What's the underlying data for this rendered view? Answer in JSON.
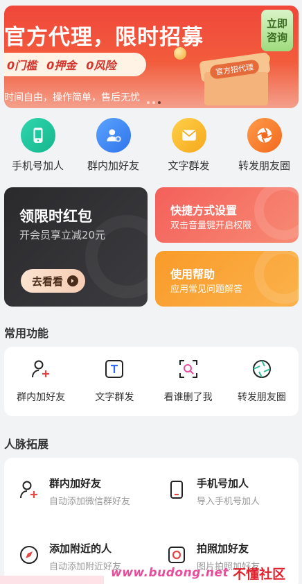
{
  "banner": {
    "title": "官方代理，限时招募",
    "perks": [
      "0门槛",
      "0押金",
      "0风险"
    ],
    "subtitle": "时间自由，操作简单，售后无忧",
    "consult": [
      "立即",
      "咨询"
    ],
    "box_tag": "官方招代理",
    "active_dot_index": 2,
    "dots_total": 3
  },
  "quick_actions": [
    {
      "label": "手机号加人",
      "icon": "phone-icon",
      "color": "#1dc9a0"
    },
    {
      "label": "群内加好友",
      "icon": "group-add-icon",
      "color": "#3d8bf5"
    },
    {
      "label": "文字群发",
      "icon": "envelope-icon",
      "color": "#f9b52a"
    },
    {
      "label": "转发朋友圈",
      "icon": "aperture-icon",
      "color": "#f77a2c"
    }
  ],
  "promos": {
    "coupon": {
      "title": "领限时红包",
      "subtitle": "开会员享立减20元",
      "button": "去看看"
    },
    "shortcut": {
      "title": "快捷方式设置",
      "subtitle": "双击音量键开启权限"
    },
    "help": {
      "title": "使用帮助",
      "subtitle": "应用常见问题解答"
    }
  },
  "common": {
    "title": "常用功能",
    "items": [
      {
        "label": "群内加好友",
        "icon": "person-add-icon"
      },
      {
        "label": "文字群发",
        "icon": "text-t-icon"
      },
      {
        "label": "看谁删了我",
        "icon": "scan-search-icon"
      },
      {
        "label": "转发朋友圈",
        "icon": "aperture-icon"
      }
    ]
  },
  "network": {
    "title": "人脉拓展",
    "items": [
      {
        "title": "群内加好友",
        "subtitle": "自动添加微信群好友",
        "icon": "person-add-icon"
      },
      {
        "title": "手机号加人",
        "subtitle": "导入手机号加人",
        "icon": "phone-icon"
      },
      {
        "title": "添加附近的人",
        "subtitle": "自动添加附近好友",
        "icon": "compass-icon"
      },
      {
        "title": "拍照加好友",
        "subtitle": "图片拍照加好友",
        "icon": "camera-icon"
      }
    ]
  },
  "watermark": {
    "url": "www.budong.net",
    "site": "不懂社区"
  },
  "colors": {
    "accent_red": "#e84545",
    "accent_blue": "#2f6bf2"
  }
}
